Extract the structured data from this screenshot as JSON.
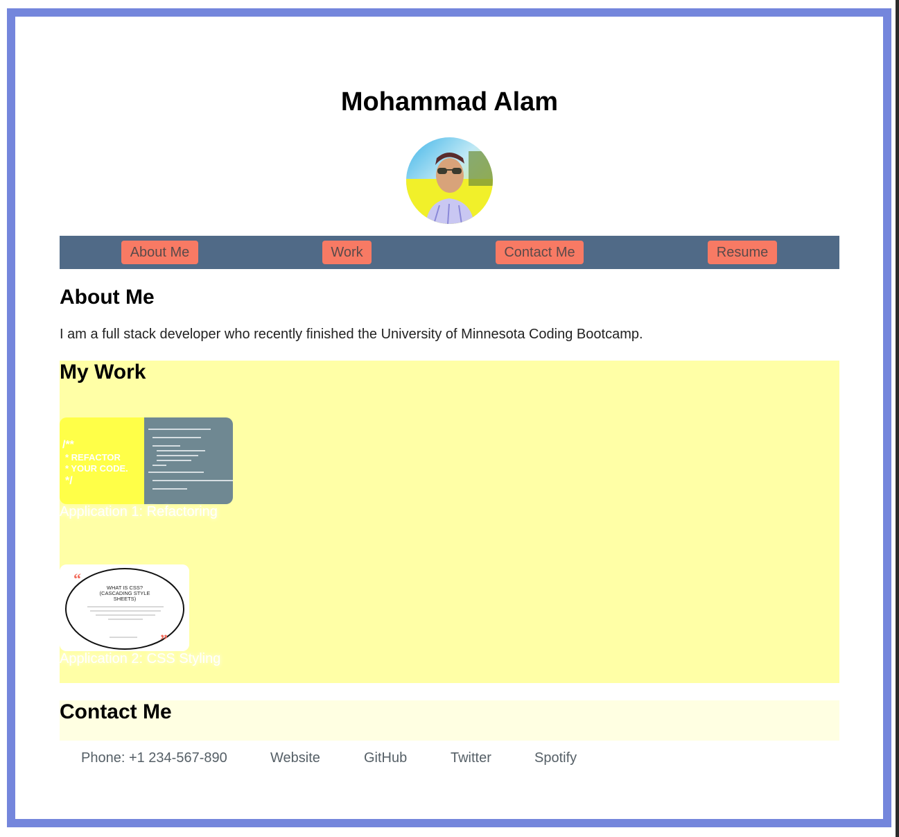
{
  "header": {
    "name": "Mohammad Alam",
    "avatar_alt": "profile photo"
  },
  "nav": {
    "items": [
      {
        "label": "About Me"
      },
      {
        "label": "Work"
      },
      {
        "label": "Contact Me"
      },
      {
        "label": "Resume"
      }
    ]
  },
  "about": {
    "heading": "About Me",
    "text": "I am a full stack developer who recently finished the University of Minnesota Coding Bootcamp."
  },
  "work": {
    "heading": "My Work",
    "projects": [
      {
        "caption": "Application 1: Refactoring",
        "image_text": [
          "/**",
          "* REFACTOR",
          "* YOUR CODE.",
          "*/"
        ]
      },
      {
        "caption": "Application 2: CSS Styling",
        "image_text": [
          "WHAT IS CSS?",
          "(CASCADING STYLE",
          "SHEETS)"
        ]
      }
    ]
  },
  "contact": {
    "heading": "Contact Me",
    "links": [
      {
        "label": "Phone: +1 234-567-890"
      },
      {
        "label": "Website"
      },
      {
        "label": "GitHub"
      },
      {
        "label": "Twitter"
      },
      {
        "label": "Spotify"
      }
    ]
  },
  "colors": {
    "frame_border": "#7486dc",
    "nav_background": "#506a87",
    "nav_button": "#f87a64",
    "work_background": "#ffffa6",
    "contact_background": "#ffffe2"
  }
}
